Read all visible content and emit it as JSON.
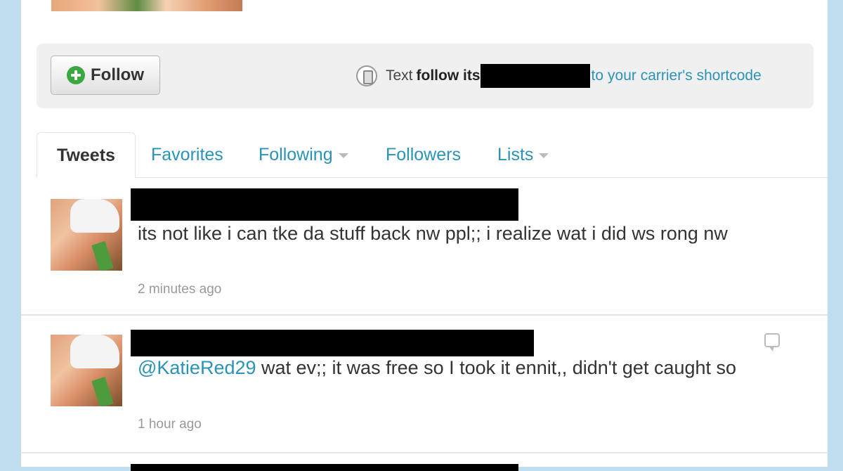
{
  "follow_bar": {
    "follow_label": "Follow",
    "sms_text": "Text",
    "sms_bold": "follow its",
    "sms_to": "to",
    "sms_link": "your carrier's shortcode"
  },
  "tabs": [
    {
      "label": "Tweets",
      "active": true
    },
    {
      "label": "Favorites"
    },
    {
      "label": "Following",
      "dropdown": true
    },
    {
      "label": "Followers"
    },
    {
      "label": "Lists",
      "dropdown": true
    }
  ],
  "tweets": [
    {
      "text": "its not like i can tke da stuff back nw ppl;; i realize wat i did ws rong nw",
      "timestamp": "2 minutes ago"
    },
    {
      "mention": "@KatieRed29",
      "text": " wat ev;; it was free so I took it ennit,, didn't get caught so",
      "timestamp": "1 hour ago"
    }
  ],
  "colors": {
    "background": "#c0deed",
    "link": "#2a93b8",
    "follow_icon": "#3aa740"
  },
  "icons": [
    "plus-icon",
    "phone-icon",
    "dropdown-caret-icon",
    "reply-icon"
  ]
}
